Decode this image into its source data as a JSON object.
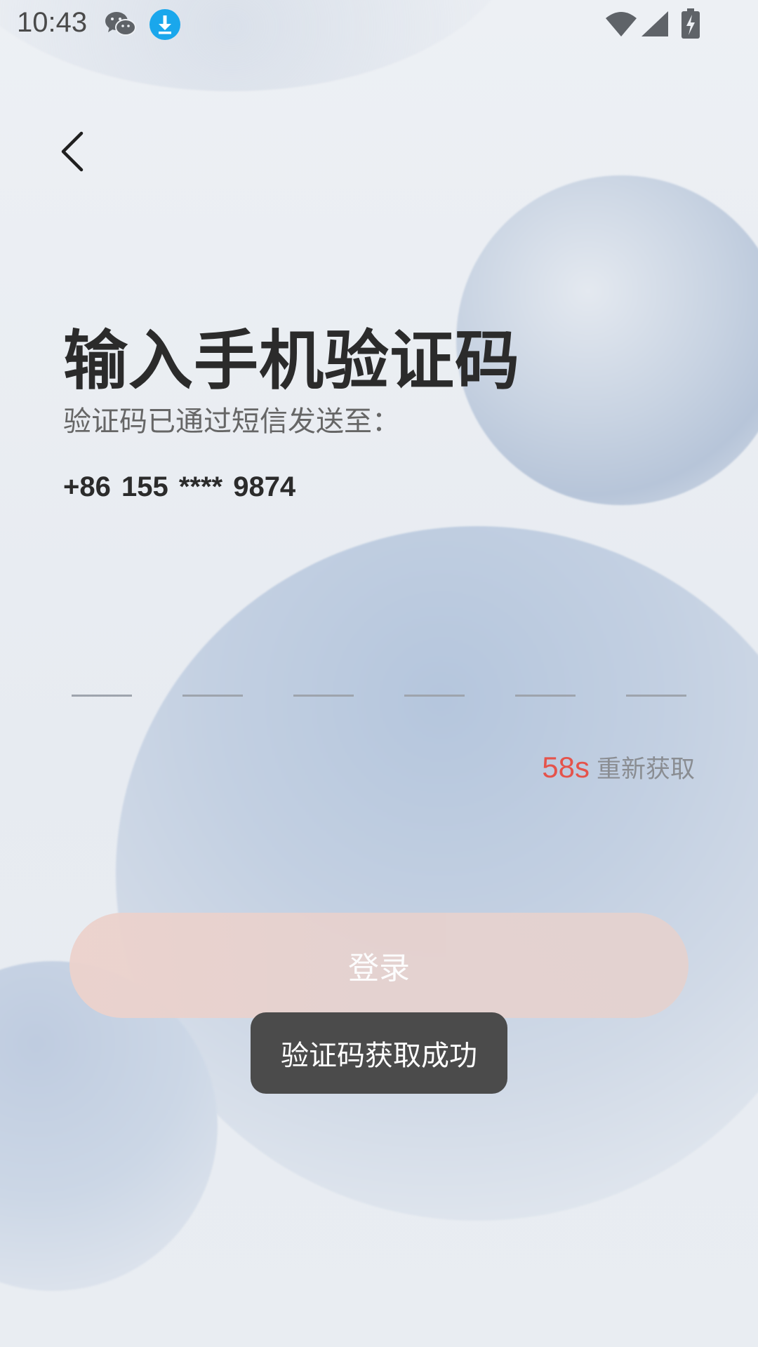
{
  "status_bar": {
    "time": "10:43",
    "icons": [
      "wechat-icon",
      "download-icon",
      "wifi-icon",
      "signal-icon",
      "battery-charging-icon"
    ]
  },
  "header": {
    "back_icon": "chevron-left-icon"
  },
  "main": {
    "title": "输入手机验证码",
    "subtitle": "验证码已通过短信发送至：",
    "phone_number": "+86  155 **** 9874",
    "code_slots": 6,
    "countdown": "58s",
    "resend_label": "重新获取",
    "login_label": "登录"
  },
  "toast": {
    "message": "验证码获取成功"
  },
  "colors": {
    "accent_red": "#e5534b",
    "login_button": "#ead3cf",
    "toast_bg": "#4b4b4b",
    "title_text": "#2b2b2b"
  }
}
